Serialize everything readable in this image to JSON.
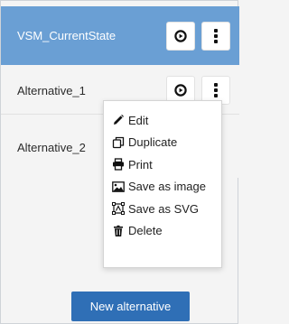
{
  "rows": [
    {
      "label": "VSM_CurrentState",
      "active": true
    },
    {
      "label": "Alternative_1",
      "active": false
    },
    {
      "label": "Alternative_2",
      "active": false
    }
  ],
  "context_menu": {
    "items": [
      {
        "label": "Edit",
        "icon": "pencil-icon"
      },
      {
        "label": "Duplicate",
        "icon": "copy-icon"
      },
      {
        "label": "Print",
        "icon": "printer-icon"
      },
      {
        "label": "Save as image",
        "icon": "image-icon"
      },
      {
        "label": "Save as SVG",
        "icon": "svg-export-icon"
      },
      {
        "label": "Delete",
        "icon": "trash-icon"
      }
    ]
  },
  "new_alternative_label": "New alternative",
  "colors": {
    "active_row": "#6a9fd4",
    "primary_button": "#2f6fb6",
    "background": "#f4f4f4"
  }
}
